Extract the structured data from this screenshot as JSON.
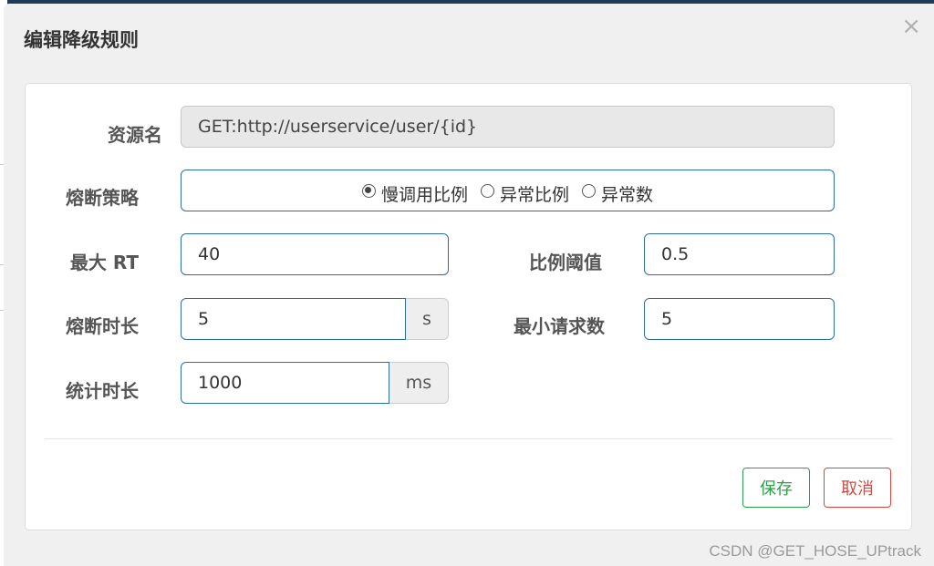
{
  "dialog": {
    "title": "编辑降级规则",
    "close_symbol": "×"
  },
  "form": {
    "resource_name": {
      "label": "资源名",
      "value": "GET:http://userservice/user/{id}"
    },
    "breaker_strategy": {
      "label": "熔断策略",
      "options": [
        {
          "label": "慢调用比例",
          "checked": true
        },
        {
          "label": "异常比例",
          "checked": false
        },
        {
          "label": "异常数",
          "checked": false
        }
      ]
    },
    "max_rt": {
      "label": "最大 RT",
      "value": "40"
    },
    "ratio_threshold": {
      "label": "比例阈值",
      "value": "0.5"
    },
    "break_duration": {
      "label": "熔断时长",
      "value": "5",
      "unit": "s"
    },
    "min_request_count": {
      "label": "最小请求数",
      "value": "5"
    },
    "stat_duration": {
      "label": "统计时长",
      "value": "1000",
      "unit": "ms"
    }
  },
  "buttons": {
    "save_label": "保存",
    "cancel_label": "取消"
  },
  "watermark": "CSDN @GET_HOSE_UPtrack",
  "colors": {
    "input_border": "#2e6da4",
    "save": "#2e9e4a",
    "cancel": "#d9443f"
  }
}
